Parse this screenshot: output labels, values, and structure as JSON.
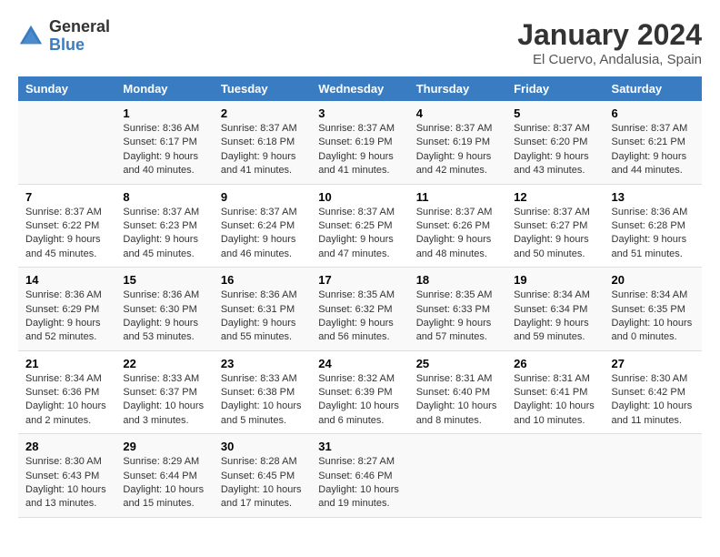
{
  "logo": {
    "general": "General",
    "blue": "Blue"
  },
  "title": "January 2024",
  "subtitle": "El Cuervo, Andalusia, Spain",
  "weekdays": [
    "Sunday",
    "Monday",
    "Tuesday",
    "Wednesday",
    "Thursday",
    "Friday",
    "Saturday"
  ],
  "weeks": [
    [
      {
        "day": "",
        "sunrise": "",
        "sunset": "",
        "daylight": ""
      },
      {
        "day": "1",
        "sunrise": "Sunrise: 8:36 AM",
        "sunset": "Sunset: 6:17 PM",
        "daylight": "Daylight: 9 hours and 40 minutes."
      },
      {
        "day": "2",
        "sunrise": "Sunrise: 8:37 AM",
        "sunset": "Sunset: 6:18 PM",
        "daylight": "Daylight: 9 hours and 41 minutes."
      },
      {
        "day": "3",
        "sunrise": "Sunrise: 8:37 AM",
        "sunset": "Sunset: 6:19 PM",
        "daylight": "Daylight: 9 hours and 41 minutes."
      },
      {
        "day": "4",
        "sunrise": "Sunrise: 8:37 AM",
        "sunset": "Sunset: 6:19 PM",
        "daylight": "Daylight: 9 hours and 42 minutes."
      },
      {
        "day": "5",
        "sunrise": "Sunrise: 8:37 AM",
        "sunset": "Sunset: 6:20 PM",
        "daylight": "Daylight: 9 hours and 43 minutes."
      },
      {
        "day": "6",
        "sunrise": "Sunrise: 8:37 AM",
        "sunset": "Sunset: 6:21 PM",
        "daylight": "Daylight: 9 hours and 44 minutes."
      }
    ],
    [
      {
        "day": "7",
        "sunrise": "Sunrise: 8:37 AM",
        "sunset": "Sunset: 6:22 PM",
        "daylight": "Daylight: 9 hours and 45 minutes."
      },
      {
        "day": "8",
        "sunrise": "Sunrise: 8:37 AM",
        "sunset": "Sunset: 6:23 PM",
        "daylight": "Daylight: 9 hours and 45 minutes."
      },
      {
        "day": "9",
        "sunrise": "Sunrise: 8:37 AM",
        "sunset": "Sunset: 6:24 PM",
        "daylight": "Daylight: 9 hours and 46 minutes."
      },
      {
        "day": "10",
        "sunrise": "Sunrise: 8:37 AM",
        "sunset": "Sunset: 6:25 PM",
        "daylight": "Daylight: 9 hours and 47 minutes."
      },
      {
        "day": "11",
        "sunrise": "Sunrise: 8:37 AM",
        "sunset": "Sunset: 6:26 PM",
        "daylight": "Daylight: 9 hours and 48 minutes."
      },
      {
        "day": "12",
        "sunrise": "Sunrise: 8:37 AM",
        "sunset": "Sunset: 6:27 PM",
        "daylight": "Daylight: 9 hours and 50 minutes."
      },
      {
        "day": "13",
        "sunrise": "Sunrise: 8:36 AM",
        "sunset": "Sunset: 6:28 PM",
        "daylight": "Daylight: 9 hours and 51 minutes."
      }
    ],
    [
      {
        "day": "14",
        "sunrise": "Sunrise: 8:36 AM",
        "sunset": "Sunset: 6:29 PM",
        "daylight": "Daylight: 9 hours and 52 minutes."
      },
      {
        "day": "15",
        "sunrise": "Sunrise: 8:36 AM",
        "sunset": "Sunset: 6:30 PM",
        "daylight": "Daylight: 9 hours and 53 minutes."
      },
      {
        "day": "16",
        "sunrise": "Sunrise: 8:36 AM",
        "sunset": "Sunset: 6:31 PM",
        "daylight": "Daylight: 9 hours and 55 minutes."
      },
      {
        "day": "17",
        "sunrise": "Sunrise: 8:35 AM",
        "sunset": "Sunset: 6:32 PM",
        "daylight": "Daylight: 9 hours and 56 minutes."
      },
      {
        "day": "18",
        "sunrise": "Sunrise: 8:35 AM",
        "sunset": "Sunset: 6:33 PM",
        "daylight": "Daylight: 9 hours and 57 minutes."
      },
      {
        "day": "19",
        "sunrise": "Sunrise: 8:34 AM",
        "sunset": "Sunset: 6:34 PM",
        "daylight": "Daylight: 9 hours and 59 minutes."
      },
      {
        "day": "20",
        "sunrise": "Sunrise: 8:34 AM",
        "sunset": "Sunset: 6:35 PM",
        "daylight": "Daylight: 10 hours and 0 minutes."
      }
    ],
    [
      {
        "day": "21",
        "sunrise": "Sunrise: 8:34 AM",
        "sunset": "Sunset: 6:36 PM",
        "daylight": "Daylight: 10 hours and 2 minutes."
      },
      {
        "day": "22",
        "sunrise": "Sunrise: 8:33 AM",
        "sunset": "Sunset: 6:37 PM",
        "daylight": "Daylight: 10 hours and 3 minutes."
      },
      {
        "day": "23",
        "sunrise": "Sunrise: 8:33 AM",
        "sunset": "Sunset: 6:38 PM",
        "daylight": "Daylight: 10 hours and 5 minutes."
      },
      {
        "day": "24",
        "sunrise": "Sunrise: 8:32 AM",
        "sunset": "Sunset: 6:39 PM",
        "daylight": "Daylight: 10 hours and 6 minutes."
      },
      {
        "day": "25",
        "sunrise": "Sunrise: 8:31 AM",
        "sunset": "Sunset: 6:40 PM",
        "daylight": "Daylight: 10 hours and 8 minutes."
      },
      {
        "day": "26",
        "sunrise": "Sunrise: 8:31 AM",
        "sunset": "Sunset: 6:41 PM",
        "daylight": "Daylight: 10 hours and 10 minutes."
      },
      {
        "day": "27",
        "sunrise": "Sunrise: 8:30 AM",
        "sunset": "Sunset: 6:42 PM",
        "daylight": "Daylight: 10 hours and 11 minutes."
      }
    ],
    [
      {
        "day": "28",
        "sunrise": "Sunrise: 8:30 AM",
        "sunset": "Sunset: 6:43 PM",
        "daylight": "Daylight: 10 hours and 13 minutes."
      },
      {
        "day": "29",
        "sunrise": "Sunrise: 8:29 AM",
        "sunset": "Sunset: 6:44 PM",
        "daylight": "Daylight: 10 hours and 15 minutes."
      },
      {
        "day": "30",
        "sunrise": "Sunrise: 8:28 AM",
        "sunset": "Sunset: 6:45 PM",
        "daylight": "Daylight: 10 hours and 17 minutes."
      },
      {
        "day": "31",
        "sunrise": "Sunrise: 8:27 AM",
        "sunset": "Sunset: 6:46 PM",
        "daylight": "Daylight: 10 hours and 19 minutes."
      },
      {
        "day": "",
        "sunrise": "",
        "sunset": "",
        "daylight": ""
      },
      {
        "day": "",
        "sunrise": "",
        "sunset": "",
        "daylight": ""
      },
      {
        "day": "",
        "sunrise": "",
        "sunset": "",
        "daylight": ""
      }
    ]
  ]
}
